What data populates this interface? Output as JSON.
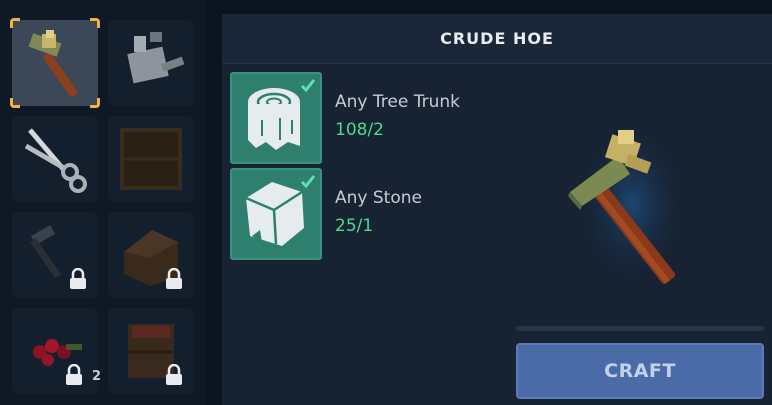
{
  "recipe": {
    "title": "CRUDE HOE",
    "craft_label": "CRAFT",
    "ingredients": [
      {
        "name": "Any Tree Trunk",
        "quantity": "108/2",
        "icon": "tree-trunk-icon",
        "fulfilled": true
      },
      {
        "name": "Any Stone",
        "quantity": "25/1",
        "icon": "stone-icon",
        "fulfilled": true
      }
    ]
  },
  "inventory_grid": {
    "slots": [
      {
        "item": "crude-hoe",
        "selected": true,
        "locked": false
      },
      {
        "item": "watering-can",
        "selected": false,
        "locked": false
      },
      {
        "item": "shears",
        "selected": false,
        "locked": false
      },
      {
        "item": "wooden-crate",
        "selected": false,
        "locked": false
      },
      {
        "item": "hammer",
        "selected": false,
        "locked": true
      },
      {
        "item": "wooden-structure",
        "selected": false,
        "locked": true
      },
      {
        "item": "red-berries",
        "selected": false,
        "locked": true,
        "count": "2"
      },
      {
        "item": "wooden-bin",
        "selected": false,
        "locked": true
      }
    ]
  },
  "colors": {
    "ingredient_ok": "#2f7f6e",
    "quantity_text": "#4fd98a",
    "selection_corner": "#f2b23c",
    "craft_button": "#4a6aa8"
  }
}
